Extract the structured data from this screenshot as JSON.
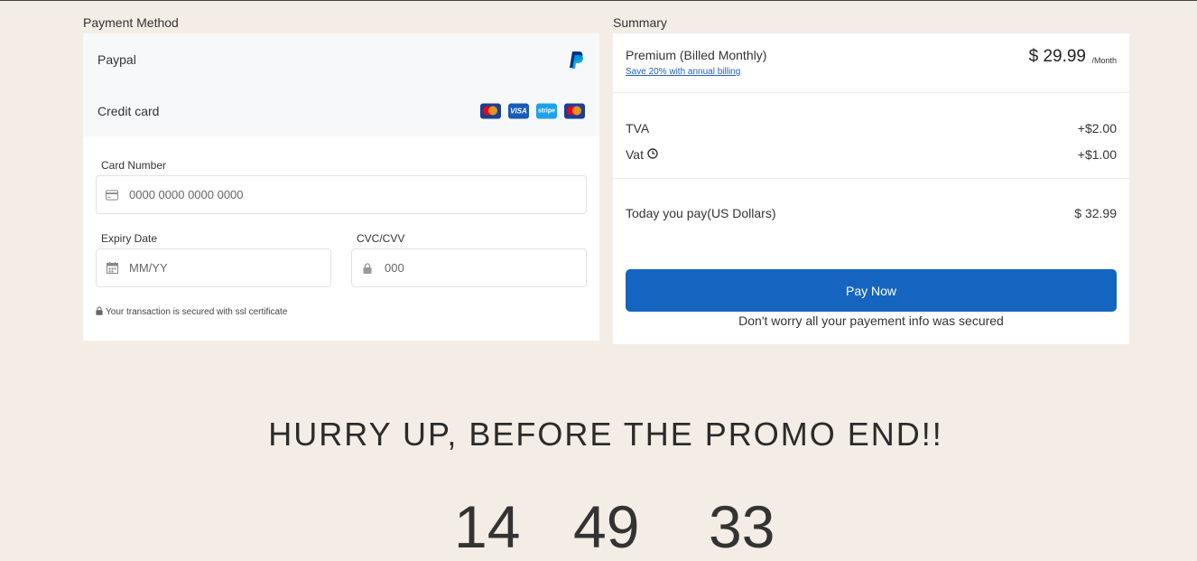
{
  "left": {
    "section_label": "Payment Method",
    "paypal_label": "Paypal",
    "credit_label": "Credit card",
    "card_logos": [
      "mastercard",
      "visa",
      "stripe",
      "mastercard"
    ],
    "card_number": {
      "label": "Card Number",
      "placeholder": "0000 0000 0000 0000"
    },
    "expiry": {
      "label": "Expiry Date",
      "placeholder": "MM/YY"
    },
    "cvc": {
      "label": "CVC/CVV",
      "placeholder": "000"
    },
    "secure_note": "Your transaction is secured with ssl certificate"
  },
  "summary": {
    "section_label": "Summary",
    "plan": "Premium (Billed Monthly)",
    "save_link": "Save 20% with annual billing",
    "price": "$ 29.99",
    "per": "/Month",
    "tva_label": "TVA",
    "tva_value": "+$2.00",
    "vat_label": "Vat",
    "vat_value": "+$1.00",
    "total_label": "Today you pay(US Dollars)",
    "total_value": "$ 32.99",
    "pay_button": "Pay Now",
    "secured_msg": "Don't worry all your payement info was secured"
  },
  "promo": {
    "title": "HURRY UP, BEFORE THE PROMO END!!",
    "countdown": [
      "14",
      "49",
      "33"
    ]
  },
  "colors": {
    "accent": "#1565c0",
    "background": "#f4ede6",
    "link": "#2060c0"
  }
}
